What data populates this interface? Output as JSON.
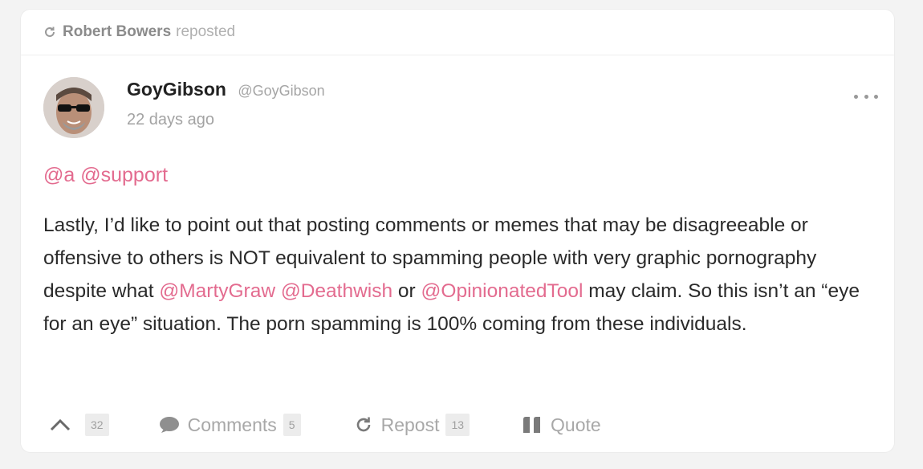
{
  "repost_header": {
    "user": "Robert Bowers",
    "action": "reposted"
  },
  "post": {
    "author": {
      "display_name": "GoyGibson",
      "handle": "@GoyGibson"
    },
    "timestamp": "22 days ago",
    "mentions": [
      "@a",
      "@support"
    ],
    "body": {
      "part1": "Lastly, I’d like to point out that posting comments or memes that may be disagreeable or offensive to others is NOT equivalent to spamming people with very graphic pornography despite what ",
      "mention1": "@MartyGraw",
      "space1": " ",
      "mention2": "@Deathwish",
      "part2": " or ",
      "mention3": "@OpinionatedTool",
      "part3": " may claim. So this isn’t an “eye for an eye” situation. The porn spamming is 100% coming from these individuals."
    }
  },
  "actions": {
    "upvote_count": "32",
    "comments_label": "Comments",
    "comments_count": "5",
    "repost_label": "Repost",
    "repost_count": "13",
    "quote_label": "Quote"
  },
  "colors": {
    "mention": "#e36b8f",
    "text": "#2a2a2a",
    "muted": "#a8a8a8"
  }
}
